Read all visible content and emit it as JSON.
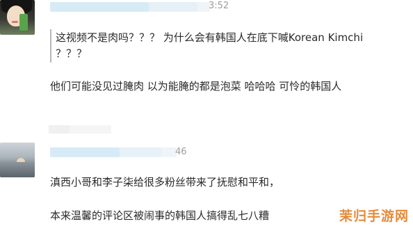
{
  "comments": [
    {
      "avatar_icon": "girl-with-phone-avatar",
      "timestamp_partial": "3:52",
      "quote_lines": [
        "这视频不是肉吗？？？ 为什么会有韩国人在底下喊Korean Kimchi",
        "？？？"
      ],
      "reply": "他们可能没见过腌肉 以为能腌的都是泡菜 哈哈哈 可怜的韩国人"
    },
    {
      "avatar_icon": "sunset-sea-avatar",
      "timestamp_partial": "46",
      "lines": [
        "滇西小哥和李子柒给很多粉丝带来了抚慰和平和，",
        "本来温馨的评论区被闹事的韩国人搞得乱七八糟"
      ]
    }
  ],
  "watermark": "茉归手游网",
  "colors": {
    "blurred_meta": "#d7ebf6",
    "text": "#2a2a2a",
    "timestamp": "#9b9b9b",
    "watermark": "#e58a3a"
  }
}
